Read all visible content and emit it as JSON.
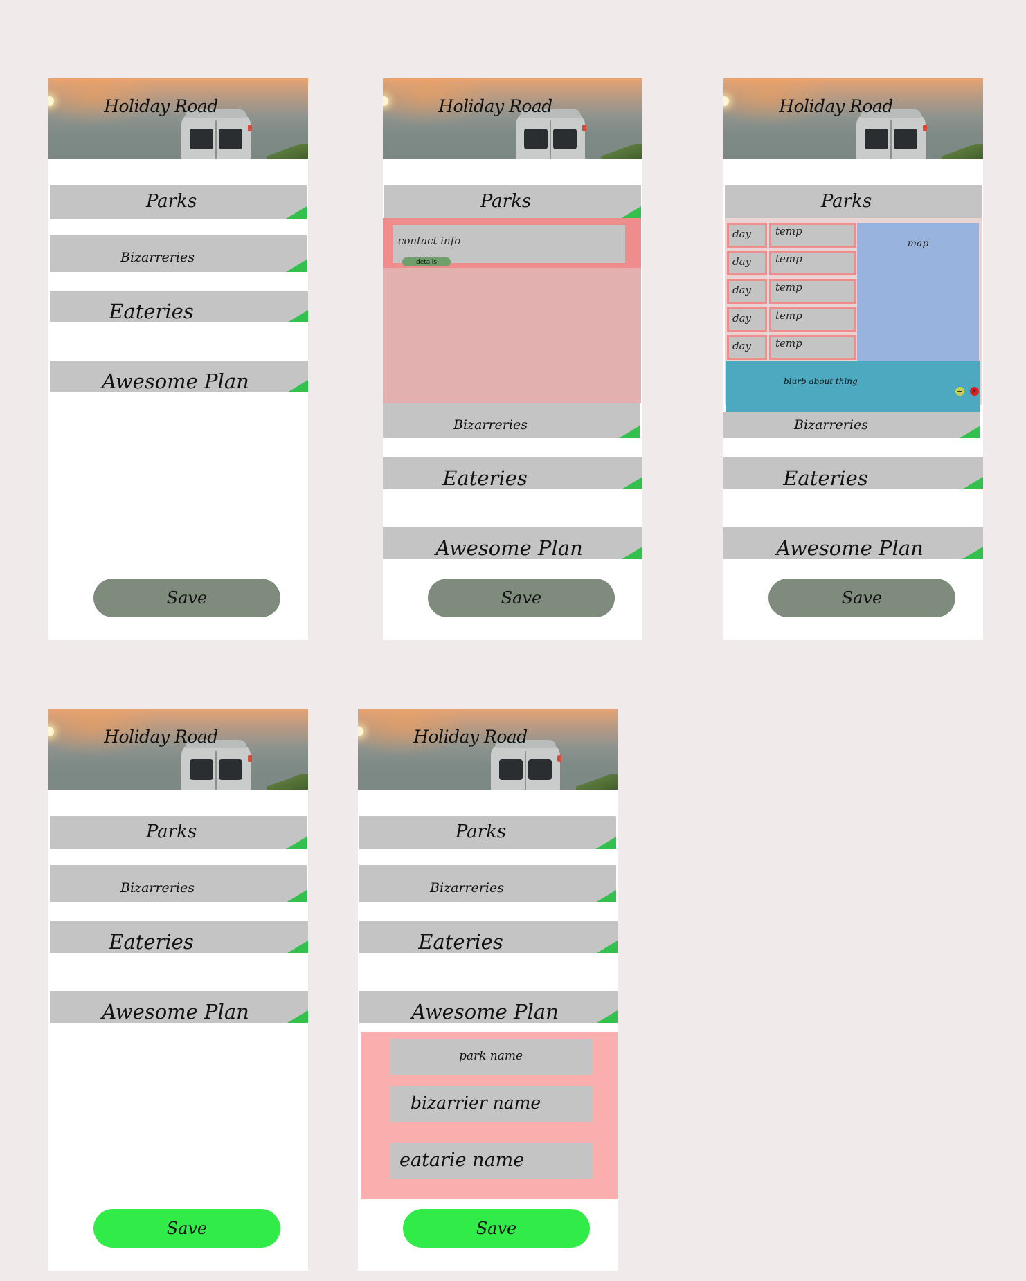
{
  "app": {
    "title": "Holiday Road",
    "sections": {
      "parks": "Parks",
      "bizarreries": "Bizarreries",
      "eateries": "Eateries",
      "plan": "Awesome Plan"
    },
    "save_label": "Save"
  },
  "park_detail": {
    "contact_info": "contact info",
    "details_button": "details"
  },
  "weather": {
    "rows": [
      {
        "day": "day",
        "temp": "temp"
      },
      {
        "day": "day",
        "temp": "temp"
      },
      {
        "day": "day",
        "temp": "temp"
      },
      {
        "day": "day",
        "temp": "temp"
      },
      {
        "day": "day",
        "temp": "temp"
      }
    ],
    "map_label": "map",
    "blurb": "blurb about thing",
    "add_glyph": "+",
    "remove_glyph": "x"
  },
  "itinerary": {
    "park_name": "park name",
    "bizarrerie_name": "bizarrier name",
    "eatery_name": "eatarie name"
  },
  "colors": {
    "save_inactive": "#7e8b7d",
    "save_active": "#30eb48",
    "accent_green": "#34c04c"
  }
}
